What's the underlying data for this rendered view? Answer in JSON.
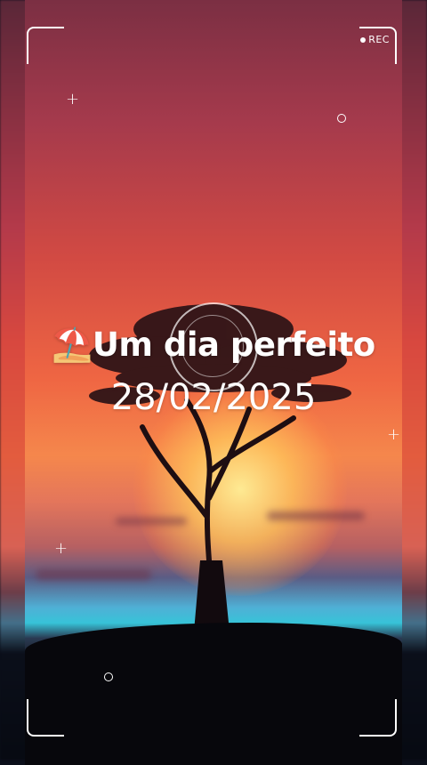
{
  "overlay": {
    "rec_label": "REC"
  },
  "caption": {
    "emoji": "⛱️",
    "title": "Um dia perfeito",
    "date": "28/02/2025"
  },
  "scene": {
    "description_icon": "sunset-tree-icon",
    "colors": {
      "sky_top": "#7b2f43",
      "sky_mid": "#d24a43",
      "horizon": "#f5874c",
      "water": "#37c3d8",
      "ground": "#07070c"
    }
  }
}
